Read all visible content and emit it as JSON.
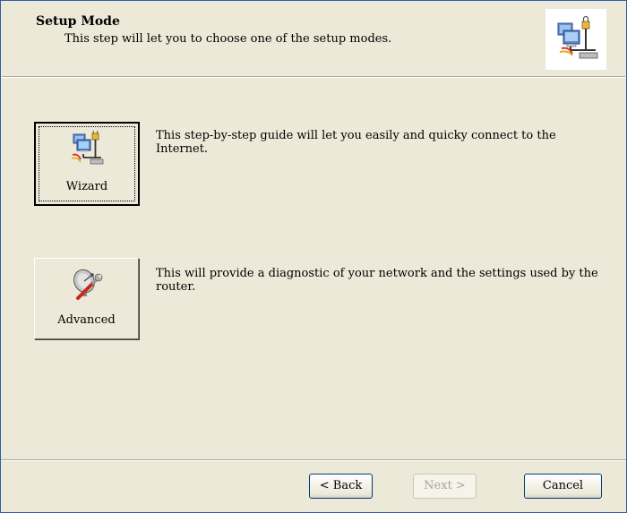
{
  "header": {
    "title": "Setup Mode",
    "subtitle": "This step will let you to choose one of the setup modes."
  },
  "modes": [
    {
      "label": "Wizard",
      "description": "This step-by-step guide will let you easily and quicky connect to the Internet.",
      "icon": "network-computers-icon",
      "is_default": true
    },
    {
      "label": "Advanced",
      "description": "This will provide a diagnostic of your network and the settings used by the router.",
      "icon": "satellite-dish-wrench-icon",
      "is_default": false
    }
  ],
  "footer": {
    "back_label": "< Back",
    "next_label": "Next >",
    "next_disabled": true,
    "cancel_label": "Cancel"
  }
}
